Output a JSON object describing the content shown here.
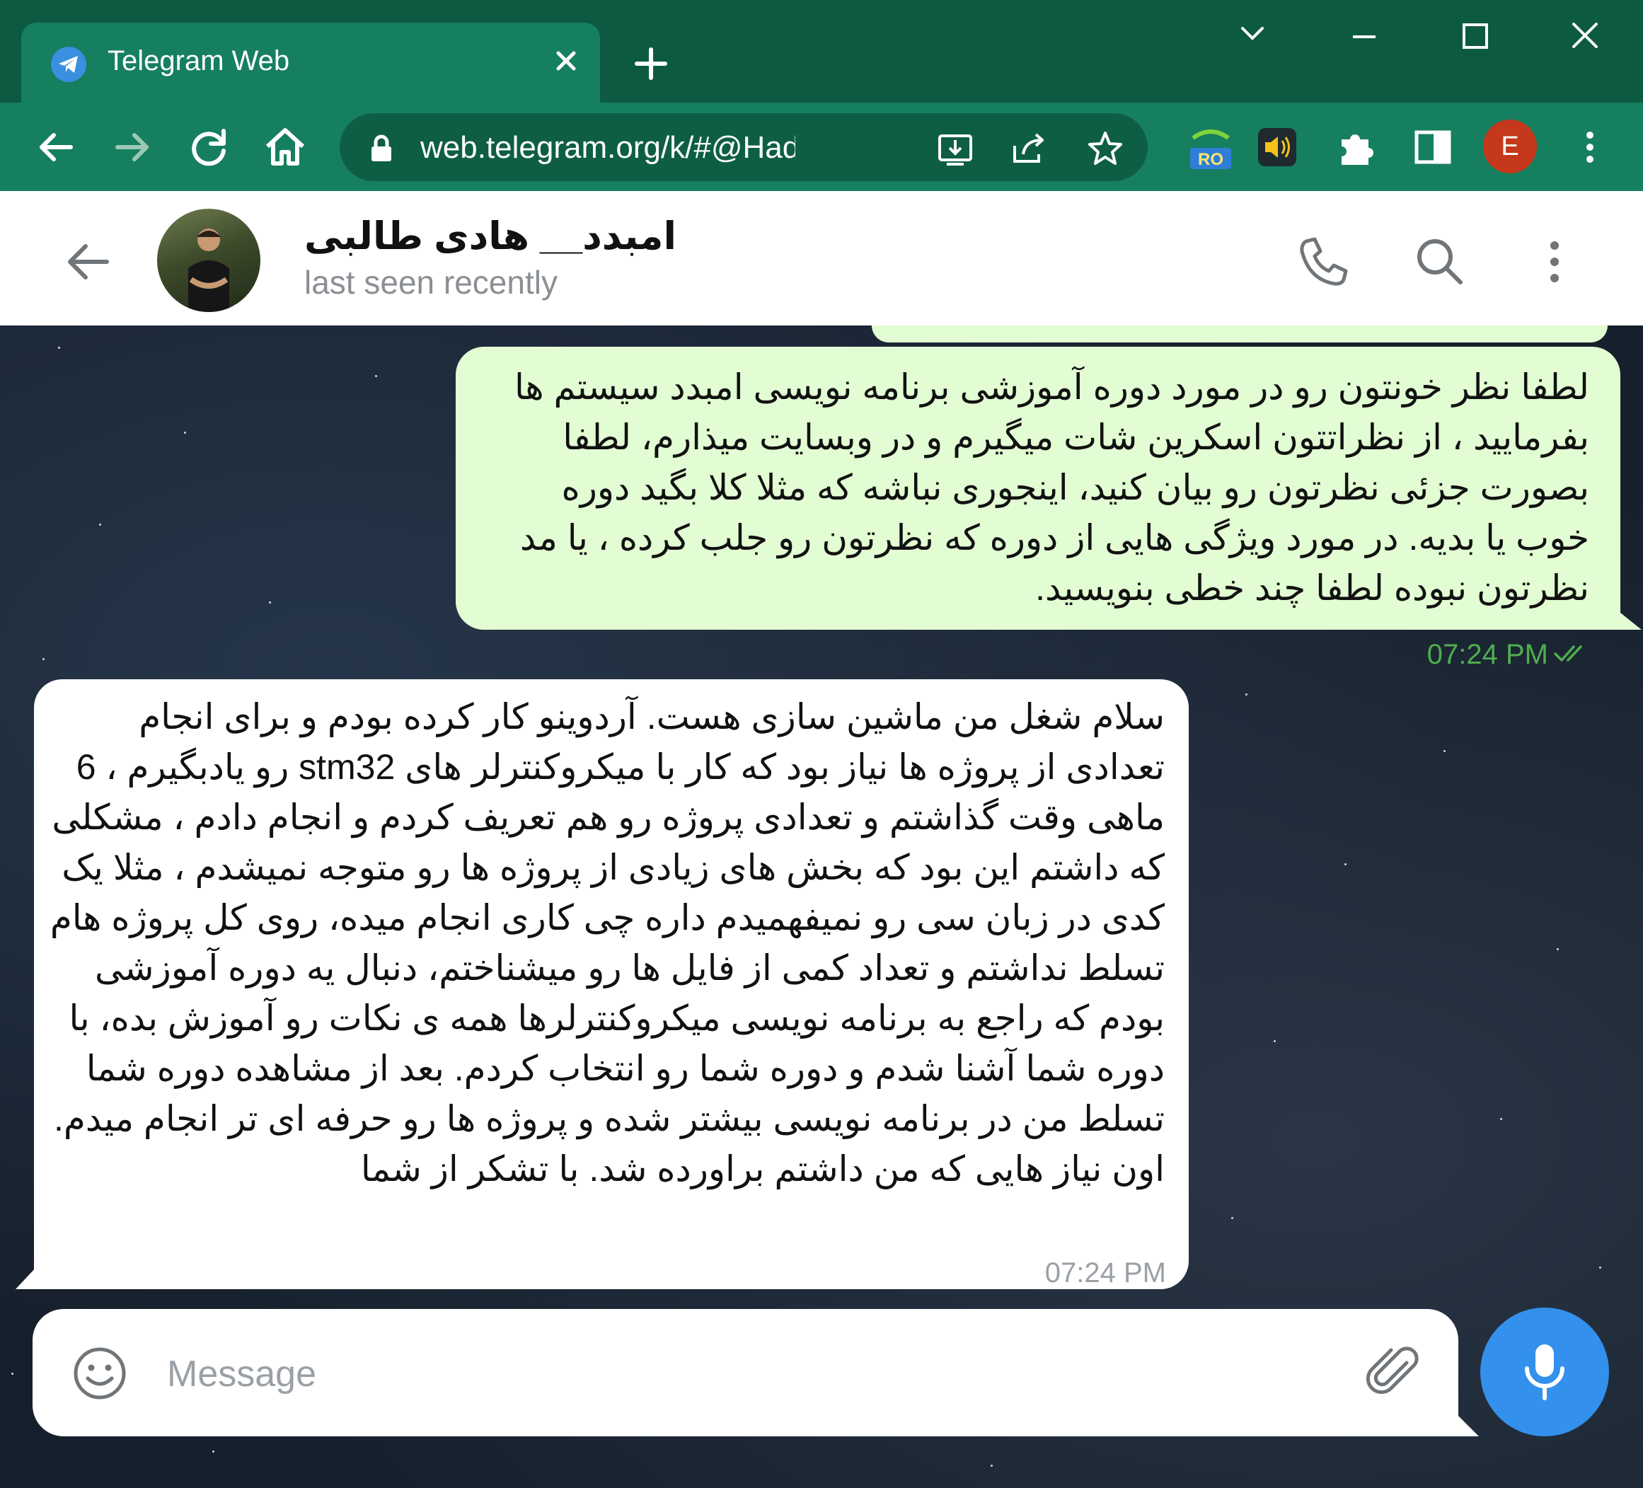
{
  "browser": {
    "tab_title": "Telegram Web",
    "url": "web.telegram.org/k/#@HadiNi...",
    "profile_initial": "E",
    "extension_badge": "RO",
    "colors": {
      "tabbar": "#0c5a41",
      "toolbar": "#167f5f",
      "profile": "#c5381b"
    }
  },
  "chat_header": {
    "name": "امبدد__ هادی طالبی",
    "status": "last seen recently"
  },
  "messages": [
    {
      "direction": "outgoing",
      "text": "لطفا نظر خونتون رو در مورد دوره آموزشی برنامه نویسی امبدد سیستم ها بفرمایید ، از نظراتتون اسکرین شات میگیرم و در وبسایت میذارم، لطفا بصورت جزئی نظرتون رو بیان کنید، اینجوری نباشه که مثلا کلا بگید دوره خوب یا بدیه. در مورد ویژگی هایی از دوره که نظرتون رو جلب کرده ، یا مد نظرتون نبوده لطفا چند خطی بنویسید.",
      "time": "07:24 PM",
      "status_icon": "double-check-icon"
    },
    {
      "direction": "incoming",
      "text": "سلام شغل من ماشین سازی هست. آردوینو کار کرده بودم و برای انجام تعدادی از پروژه ها نیاز بود که کار با میکروکنترلر های stm32 رو یادبگیرم ، 6 ماهی وقت گذاشتم و تعدادی پروژه رو هم تعریف کردم و انجام دادم ، مشکلی که داشتم این بود که بخش های زیادی از پروژه ها رو متوجه نمیشدم ، مثلا یک کدی در زبان سی رو نمیفهمیدم داره چی کاری  انجام میده، روی کل پروژه هام تسلط نداشتم و تعداد کمی از فایل ها رو میشناختم، دنبال یه دوره آموزشی بودم که راجع به برنامه نویسی میکروکنترلرها همه ی نکات رو آموزش بده، با دوره شما آشنا شدم و دوره شما رو انتخاب کردم. بعد از مشاهده دوره شما تسلط من در برنامه نویسی بیشتر شده و پروژه ها رو حرفه ای تر انجام میدم. اون نیاز هایی که من داشتم براورده شد. با تشکر از شما",
      "time": "07:24 PM"
    }
  ],
  "composer": {
    "placeholder": "Message",
    "accent_color": "#3390ec"
  },
  "icons": {
    "header": [
      "back-arrow-icon",
      "phone-icon",
      "search-icon",
      "more-vertical-icon"
    ],
    "composer": [
      "smile-icon",
      "paperclip-icon",
      "microphone-icon"
    ]
  }
}
